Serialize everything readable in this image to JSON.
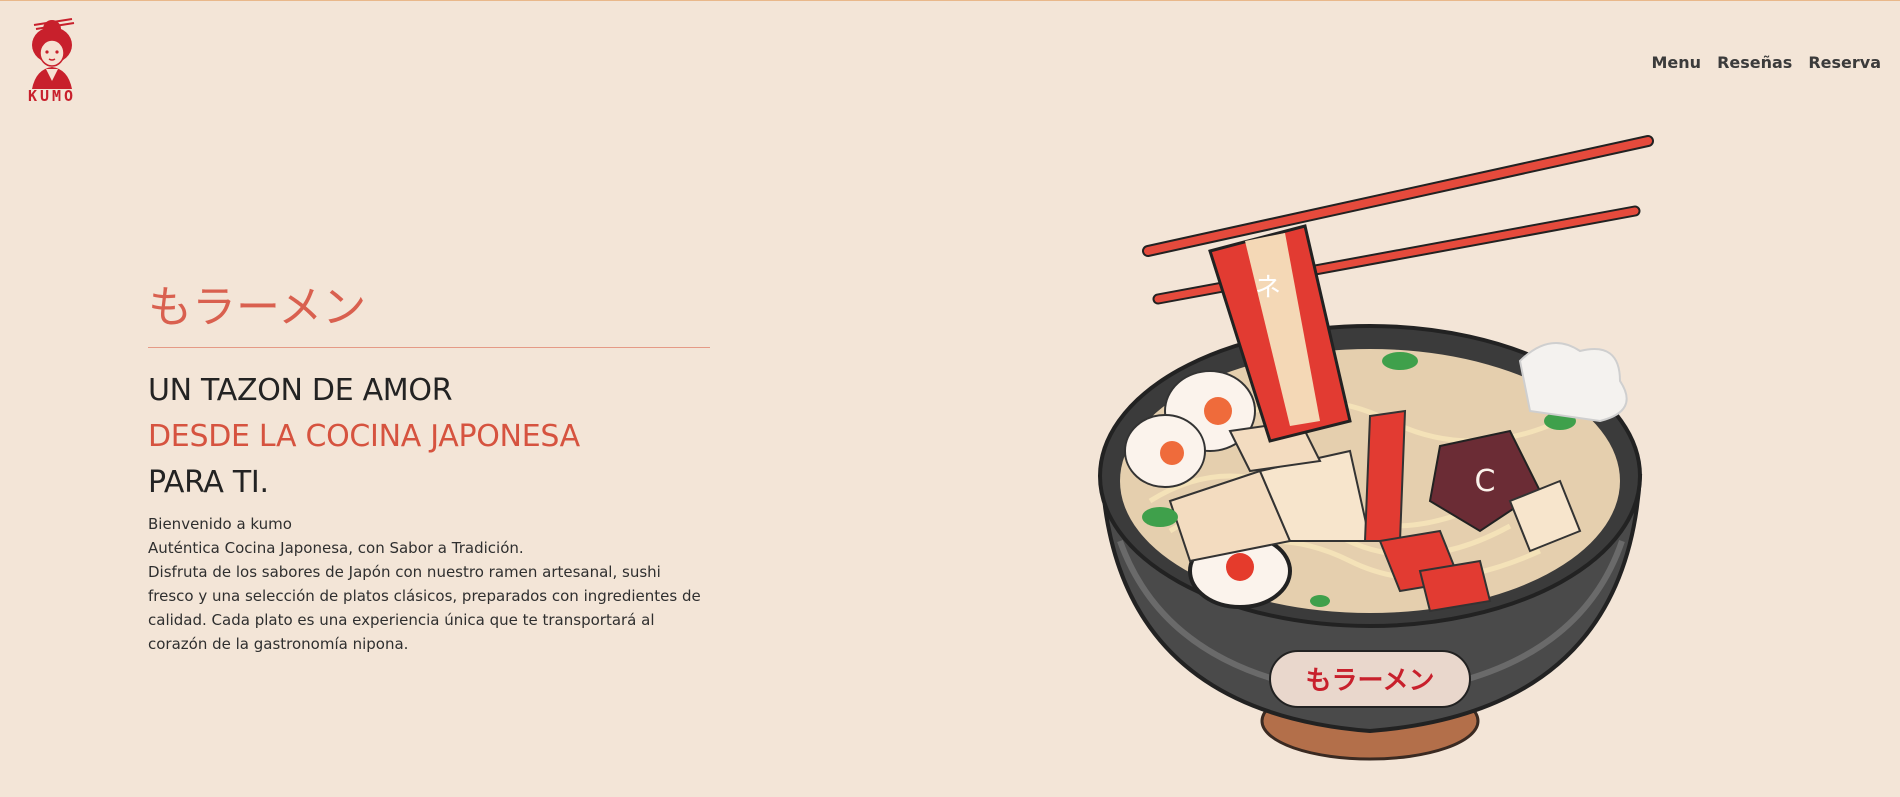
{
  "brand": {
    "name": "KUMO",
    "logo_icon": "geisha-logo-icon"
  },
  "nav": {
    "items": [
      {
        "label": "Menu"
      },
      {
        "label": "Reseñas"
      },
      {
        "label": "Reserva"
      }
    ]
  },
  "hero": {
    "jp_title": "もラーメン",
    "line1": "UN TAZON DE AMOR",
    "line2": "DESDE LA COCINA JAPONESA",
    "line3": "PARA TI.",
    "welcome": "Bienvenido a kumo",
    "tagline": "Auténtica Cocina Japonesa, con Sabor a Tradición.",
    "description": "Disfruta de los sabores de Japón con nuestro ramen artesanal, sushi fresco y una selección de platos clásicos, preparados con ingredientes de calidad. Cada plato es una experiencia única que te transportará al corazón de la gastronomía nipona."
  },
  "illustration": {
    "icon": "ramen-bowl-icon",
    "bowl_label": "もラーメン"
  },
  "colors": {
    "background": "#f3e5d7",
    "accent": "#d6533f",
    "text": "#232323"
  }
}
